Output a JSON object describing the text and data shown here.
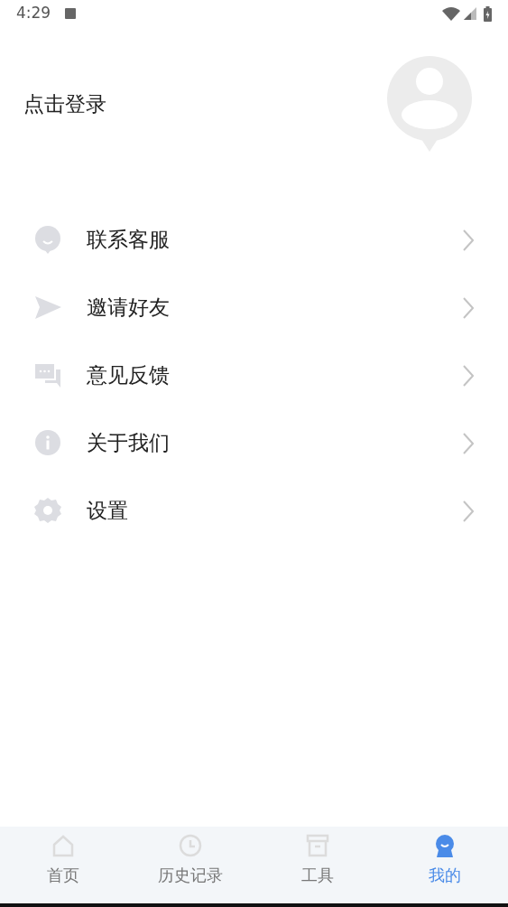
{
  "status_bar": {
    "time": "4:29"
  },
  "profile": {
    "login_label": "点击登录"
  },
  "menu": [
    {
      "kind": "chat",
      "label": "联系客服"
    },
    {
      "kind": "send",
      "label": "邀请好友"
    },
    {
      "kind": "feedback",
      "label": "意见反馈"
    },
    {
      "kind": "info",
      "label": "关于我们"
    },
    {
      "kind": "settings",
      "label": "设置"
    }
  ],
  "tabs": [
    {
      "kind": "home",
      "label": "首页",
      "selected": false
    },
    {
      "kind": "history",
      "label": "历史记录",
      "selected": false
    },
    {
      "kind": "tools",
      "label": "工具",
      "selected": false
    },
    {
      "kind": "mine",
      "label": "我的",
      "selected": true
    }
  ]
}
